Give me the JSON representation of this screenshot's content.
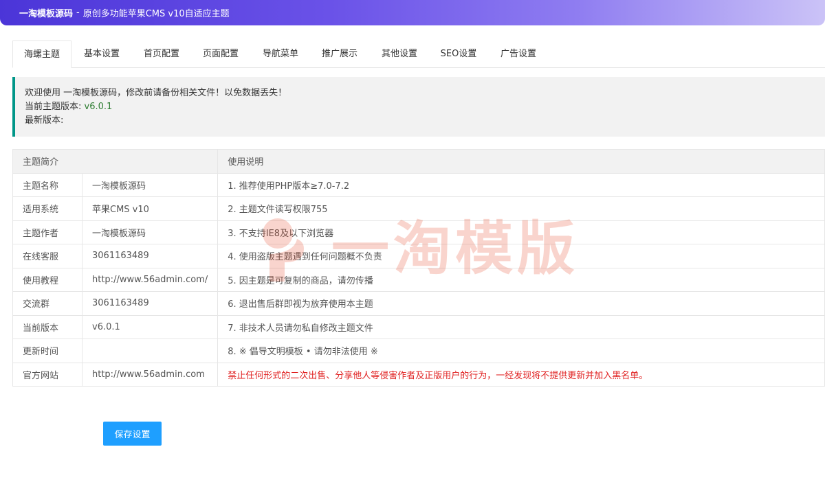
{
  "header": {
    "brand": "一淘模板源码",
    "separator": "-",
    "subtitle": "原创多功能苹果CMS v10自适应主题"
  },
  "tabs": [
    {
      "label": "海螺主题",
      "active": true
    },
    {
      "label": "基本设置"
    },
    {
      "label": "首页配置"
    },
    {
      "label": "页面配置"
    },
    {
      "label": "导航菜单"
    },
    {
      "label": "推广展示"
    },
    {
      "label": "其他设置"
    },
    {
      "label": "SEO设置"
    },
    {
      "label": "广告设置"
    }
  ],
  "notice": {
    "welcome": "欢迎使用 一淘模板源码，修改前请备份相关文件！以免数据丢失！",
    "current_version_label": "当前主题版本:",
    "current_version_value": "v6.0.1",
    "latest_version_label": "最新版本:"
  },
  "table": {
    "header": {
      "intro": "主题简介",
      "usage": "使用说明"
    },
    "rows": [
      {
        "label": "主题名称",
        "value": "一淘模板源码",
        "usage": "1. 推荐使用PHP版本≥7.0-7.2"
      },
      {
        "label": "适用系统",
        "value": "苹果CMS v10",
        "usage": "2. 主题文件读写权限755"
      },
      {
        "label": "主题作者",
        "value": "一淘模板源码",
        "usage": "3. 不支持IE8及以下浏览器"
      },
      {
        "label": "在线客服",
        "value": "3061163489",
        "usage": "4. 使用盗版主题遇到任何问题概不负责"
      },
      {
        "label": "使用教程",
        "value": "http://www.56admin.com/",
        "usage": "5. 因主题是可复制的商品，请勿传播"
      },
      {
        "label": "交流群",
        "value": "3061163489",
        "usage": "6. 退出售后群即视为放弃使用本主题"
      },
      {
        "label": "当前版本",
        "value": "v6.0.1",
        "usage": "7. 非技术人员请勿私自修改主题文件"
      },
      {
        "label": "更新时间",
        "value": "",
        "usage": "8. ※ 倡导文明模板 • 请勿非法使用 ※"
      },
      {
        "label": "官方网站",
        "value": "http://www.56admin.com",
        "usage": "禁止任何形式的二次出售、分享他人等侵害作者及正版用户的行为，一经发现将不提供更新并加入黑名单。"
      }
    ]
  },
  "watermark": {
    "text": "一淘模版"
  },
  "save_button": {
    "label": "保存设置"
  },
  "colors": {
    "accent": "#1e9fff",
    "notice_border": "#009688",
    "version_green": "#2e7d32",
    "warning_red": "#e02020"
  }
}
